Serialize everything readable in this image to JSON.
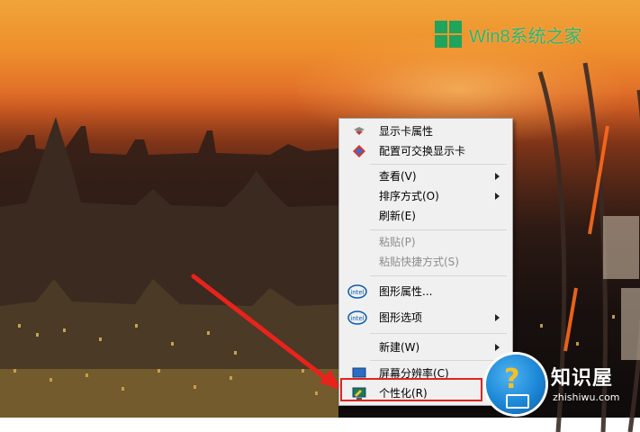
{
  "watermark": {
    "brand_text": "Win8系统之家"
  },
  "context_menu": {
    "items": [
      {
        "label": "显示卡属性",
        "icon": "display-card-icon",
        "enabled": true,
        "submenu": false
      },
      {
        "label": "配置可交换显示卡",
        "icon": "switchable-graphics-icon",
        "enabled": true,
        "submenu": false
      },
      {
        "label": "查看(V)",
        "enabled": true,
        "submenu": true
      },
      {
        "label": "排序方式(O)",
        "enabled": true,
        "submenu": true
      },
      {
        "label": "刷新(E)",
        "enabled": true,
        "submenu": false
      },
      {
        "label": "粘贴(P)",
        "enabled": false,
        "submenu": false
      },
      {
        "label": "粘贴快捷方式(S)",
        "enabled": false,
        "submenu": false
      },
      {
        "label": "图形属性...",
        "icon": "intel-icon",
        "enabled": true,
        "submenu": false
      },
      {
        "label": "图形选项",
        "icon": "intel-icon",
        "enabled": true,
        "submenu": true
      },
      {
        "label": "新建(W)",
        "enabled": true,
        "submenu": true
      },
      {
        "label": "屏幕分辨率(C)",
        "icon": "screen-resolution-icon",
        "enabled": true,
        "submenu": false
      },
      {
        "label": "个性化(R)",
        "icon": "personalize-icon",
        "enabled": true,
        "submenu": false,
        "highlighted": true
      }
    ]
  },
  "badge": {
    "title": "知识屋",
    "url": "zhishiwu.com"
  },
  "colors": {
    "highlight_border": "#e0241f",
    "annotation_arrow": "#e8231c",
    "win_logo_green": "#20a35a"
  }
}
